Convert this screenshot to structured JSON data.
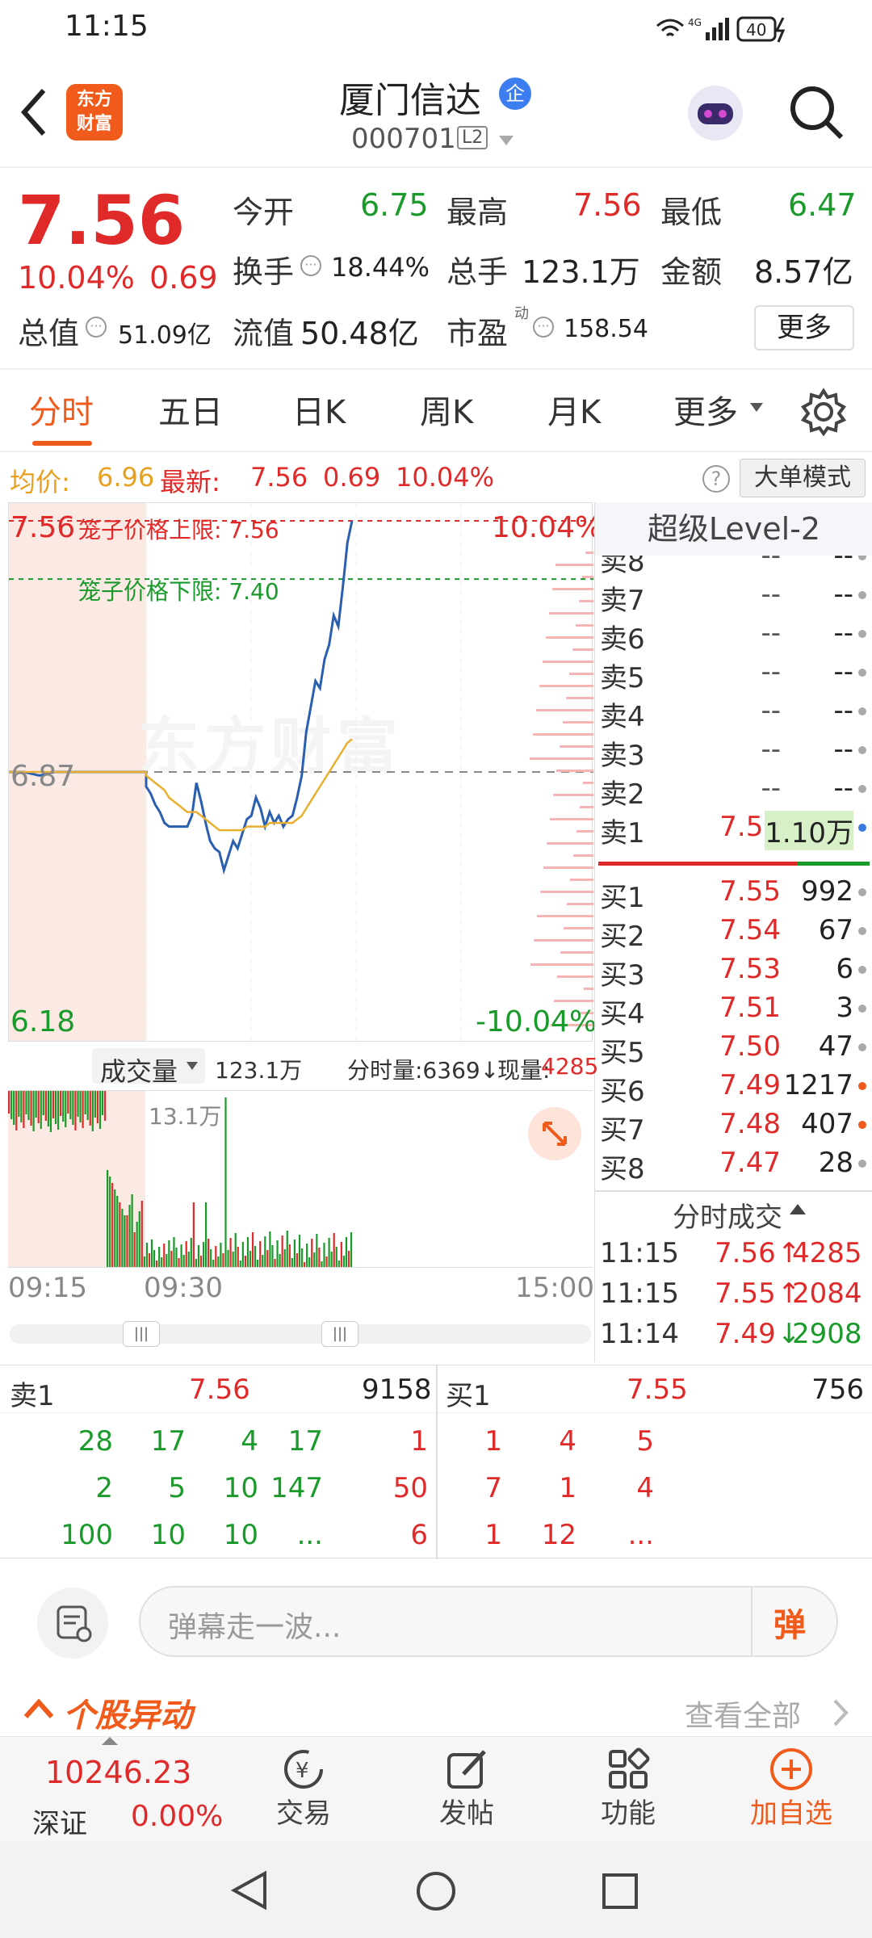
{
  "status": {
    "time": "11:15",
    "battery": "40",
    "network": "4G"
  },
  "header": {
    "brand_line1": "东方",
    "brand_line2": "财富",
    "title": "厦门信达",
    "tag": "企",
    "code": "000701",
    "level_tag": "L2"
  },
  "quote": {
    "price": "7.56",
    "change_pct": "10.04%",
    "change_amt": "0.69",
    "open_label": "今开",
    "open": "6.75",
    "high_label": "最高",
    "high": "7.56",
    "low_label": "最低",
    "low": "6.47",
    "turnover_label": "换手",
    "turnover": "18.44%",
    "volume_label": "总手",
    "volume": "123.1万",
    "amount_label": "金额",
    "amount": "8.57亿",
    "mktcap_label": "总值",
    "mktcap": "51.09亿",
    "float_label": "流值",
    "float": "50.48亿",
    "pe_label": "市盈",
    "pe_sup": "动",
    "pe": "158.54",
    "more": "更多"
  },
  "tabs": [
    "分时",
    "五日",
    "日K",
    "周K",
    "月K",
    "更多"
  ],
  "infobar": {
    "avg_label": "均价:",
    "avg": "6.96",
    "latest_label": "最新:",
    "latest": "7.56",
    "latest_chg": "0.69",
    "latest_pct": "10.04%",
    "big_order": "大单模式"
  },
  "chart": {
    "top_price": "7.56",
    "upper_limit_label": "笼子价格上限: 7.56",
    "lower_limit_label": "笼子价格下限: 7.40",
    "top_pct": "10.04%",
    "mid_price": "6.87",
    "bottom_price": "6.18",
    "bottom_pct": "-10.04%",
    "watermark": "东方财富"
  },
  "chart_data": {
    "type": "line",
    "title": "",
    "ylim": [
      6.18,
      7.56
    ],
    "prev_close": 6.87,
    "series": [
      {
        "name": "最新",
        "values": [
          6.87,
          6.87,
          6.86,
          6.87,
          6.87,
          6.87,
          6.87,
          6.87,
          6.87,
          6.87,
          6.83,
          6.81,
          6.78,
          6.76,
          6.73,
          6.72,
          6.72,
          6.72,
          6.72,
          6.72,
          6.75,
          6.84,
          6.79,
          6.73,
          6.68,
          6.66,
          6.65,
          6.6,
          6.64,
          6.68,
          6.66,
          6.7,
          6.74,
          6.75,
          6.8,
          6.77,
          6.72,
          6.76,
          6.73,
          6.75,
          6.72,
          6.74,
          6.75,
          6.8,
          6.86,
          6.98,
          7.05,
          7.12,
          7.1,
          7.18,
          7.22,
          7.3,
          7.27,
          7.38,
          7.5,
          7.56
        ]
      },
      {
        "name": "均价",
        "values": [
          6.87,
          6.87,
          6.87,
          6.87,
          6.87,
          6.87,
          6.87,
          6.87,
          6.87,
          6.87,
          6.86,
          6.85,
          6.84,
          6.83,
          6.82,
          6.8,
          6.79,
          6.78,
          6.77,
          6.76,
          6.76,
          6.76,
          6.75,
          6.74,
          6.73,
          6.72,
          6.71,
          6.71,
          6.71,
          6.71,
          6.71,
          6.71,
          6.72,
          6.72,
          6.72,
          6.72,
          6.72,
          6.73,
          6.73,
          6.73,
          6.73,
          6.73,
          6.73,
          6.74,
          6.75,
          6.77,
          6.79,
          6.81,
          6.83,
          6.85,
          6.87,
          6.89,
          6.91,
          6.93,
          6.95,
          6.96
        ]
      }
    ]
  },
  "level2": {
    "title": "超级Level-2",
    "asks": [
      {
        "label": "卖8",
        "price": "--",
        "vol": "--"
      },
      {
        "label": "卖7",
        "price": "--",
        "vol": "--"
      },
      {
        "label": "卖6",
        "price": "--",
        "vol": "--"
      },
      {
        "label": "卖5",
        "price": "--",
        "vol": "--"
      },
      {
        "label": "卖4",
        "price": "--",
        "vol": "--"
      },
      {
        "label": "卖3",
        "price": "--",
        "vol": "--"
      },
      {
        "label": "卖2",
        "price": "--",
        "vol": "--"
      },
      {
        "label": "卖1",
        "price": "7.56",
        "vol": "1.10万"
      }
    ],
    "bids": [
      {
        "label": "买1",
        "price": "7.55",
        "vol": "992"
      },
      {
        "label": "买2",
        "price": "7.54",
        "vol": "67"
      },
      {
        "label": "买3",
        "price": "7.53",
        "vol": "6"
      },
      {
        "label": "买4",
        "price": "7.51",
        "vol": "3"
      },
      {
        "label": "买5",
        "price": "7.50",
        "vol": "47"
      },
      {
        "label": "买6",
        "price": "7.49",
        "vol": "1217"
      },
      {
        "label": "买7",
        "price": "7.48",
        "vol": "407"
      },
      {
        "label": "买8",
        "price": "7.47",
        "vol": "28"
      }
    ],
    "ticks_title": "分时成交",
    "ticks": [
      {
        "time": "11:15",
        "price": "7.56",
        "arrow": "↑",
        "vol": "4285",
        "dir": "up"
      },
      {
        "time": "11:15",
        "price": "7.55",
        "arrow": "↑",
        "vol": "2084",
        "dir": "up"
      },
      {
        "time": "11:14",
        "price": "7.49",
        "arrow": "↓",
        "vol": "2908",
        "dir": "down"
      }
    ]
  },
  "volume": {
    "label": "成交量",
    "total": "123.1万",
    "minute": "分时量:6369↓",
    "current_label": "现量:",
    "current": "4285",
    "axis_max": "13.1万"
  },
  "time_axis": [
    "09:15",
    "09:30",
    "15:00"
  ],
  "queue": {
    "sell_label": "卖1",
    "sell_price": "7.56",
    "sell_total": "9158",
    "buy_label": "买1",
    "buy_price": "7.55",
    "buy_total": "756",
    "sell_rows": [
      [
        "28",
        "17",
        "4",
        "17"
      ],
      [
        "2",
        "5",
        "10",
        "147"
      ],
      [
        "100",
        "10",
        "10",
        "..."
      ]
    ],
    "buy_rows": [
      [
        "1",
        "1",
        "4",
        "5"
      ],
      [
        "50",
        "7",
        "1",
        "4"
      ],
      [
        "6",
        "1",
        "12",
        "..."
      ]
    ]
  },
  "danmu": {
    "placeholder": "弹幕走一波...",
    "send": "弹"
  },
  "news": {
    "title": "个股异动",
    "view_all": "查看全部"
  },
  "bottom_nav": {
    "index_value": "10246.23",
    "index_name": "深证",
    "index_pct": "0.00%",
    "trade": "交易",
    "post": "发帖",
    "func": "功能",
    "add": "加自选"
  },
  "colors": {
    "up": "#e02a2a",
    "down": "#1a9a2a",
    "accent": "#f05a1a",
    "line": "#2a5fb0",
    "avg": "#e8b030"
  }
}
